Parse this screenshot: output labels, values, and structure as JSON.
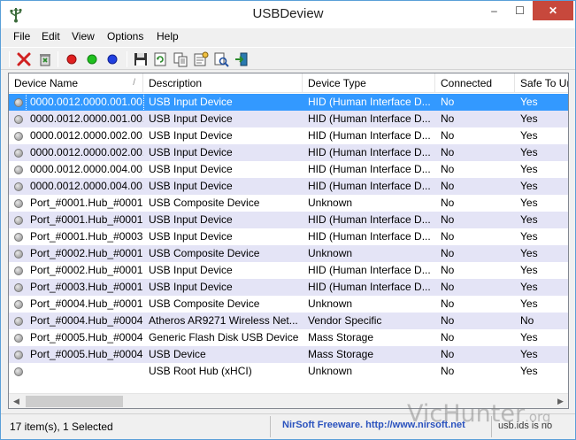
{
  "window": {
    "title": "USBDeview"
  },
  "window_controls": {
    "minimize": "–",
    "maximize": "☐",
    "close": "✕"
  },
  "menu": [
    "File",
    "Edit",
    "View",
    "Options",
    "Help"
  ],
  "toolbar": [
    {
      "icon": "delete-x-icon"
    },
    {
      "icon": "uninstall-icon"
    },
    {
      "icon": "red-dot-icon",
      "color": "#e02020"
    },
    {
      "icon": "green-dot-icon",
      "color": "#20c020"
    },
    {
      "icon": "blue-dot-icon",
      "color": "#2040e0"
    },
    {
      "icon": "save-icon"
    },
    {
      "icon": "refresh-icon"
    },
    {
      "icon": "copy-icon"
    },
    {
      "icon": "properties-icon"
    },
    {
      "icon": "find-icon"
    },
    {
      "icon": "exit-icon"
    }
  ],
  "columns": [
    "Device Name",
    "Description",
    "Device Type",
    "Connected",
    "Safe To Un"
  ],
  "rows": [
    [
      "0000.0012.0000.001.00...",
      "USB Input Device",
      "HID (Human Interface D...",
      "No",
      "Yes"
    ],
    [
      "0000.0012.0000.001.00...",
      "USB Input Device",
      "HID (Human Interface D...",
      "No",
      "Yes"
    ],
    [
      "0000.0012.0000.002.00...",
      "USB Input Device",
      "HID (Human Interface D...",
      "No",
      "Yes"
    ],
    [
      "0000.0012.0000.002.00...",
      "USB Input Device",
      "HID (Human Interface D...",
      "No",
      "Yes"
    ],
    [
      "0000.0012.0000.004.00...",
      "USB Input Device",
      "HID (Human Interface D...",
      "No",
      "Yes"
    ],
    [
      "0000.0012.0000.004.00...",
      "USB Input Device",
      "HID (Human Interface D...",
      "No",
      "Yes"
    ],
    [
      "Port_#0001.Hub_#0001",
      "USB Composite Device",
      "Unknown",
      "No",
      "Yes"
    ],
    [
      "Port_#0001.Hub_#0001",
      "USB Input Device",
      "HID (Human Interface D...",
      "No",
      "Yes"
    ],
    [
      "Port_#0001.Hub_#0003",
      "USB Input Device",
      "HID (Human Interface D...",
      "No",
      "Yes"
    ],
    [
      "Port_#0002.Hub_#0001",
      "USB Composite Device",
      "Unknown",
      "No",
      "Yes"
    ],
    [
      "Port_#0002.Hub_#0001",
      "USB Input Device",
      "HID (Human Interface D...",
      "No",
      "Yes"
    ],
    [
      "Port_#0003.Hub_#0001",
      "USB Input Device",
      "HID (Human Interface D...",
      "No",
      "Yes"
    ],
    [
      "Port_#0004.Hub_#0001",
      "USB Composite Device",
      "Unknown",
      "No",
      "Yes"
    ],
    [
      "Port_#0004.Hub_#0004",
      "Atheros AR9271 Wireless Net...",
      "Vendor Specific",
      "No",
      "No"
    ],
    [
      "Port_#0005.Hub_#0004",
      "Generic Flash Disk USB Device",
      "Mass Storage",
      "No",
      "Yes"
    ],
    [
      "Port_#0005.Hub_#0004",
      "USB Device",
      "Mass Storage",
      "No",
      "Yes"
    ],
    [
      "",
      "USB Root Hub (xHCI)",
      "Unknown",
      "No",
      "Yes"
    ]
  ],
  "selected_row": 0,
  "status": {
    "count": "17 item(s), 1 Selected",
    "link": "NirSoft Freeware.  http://www.nirsoft.net",
    "right": "usb.ids is no"
  },
  "watermark": {
    "main": "VicHunter",
    "suffix": ".org"
  }
}
